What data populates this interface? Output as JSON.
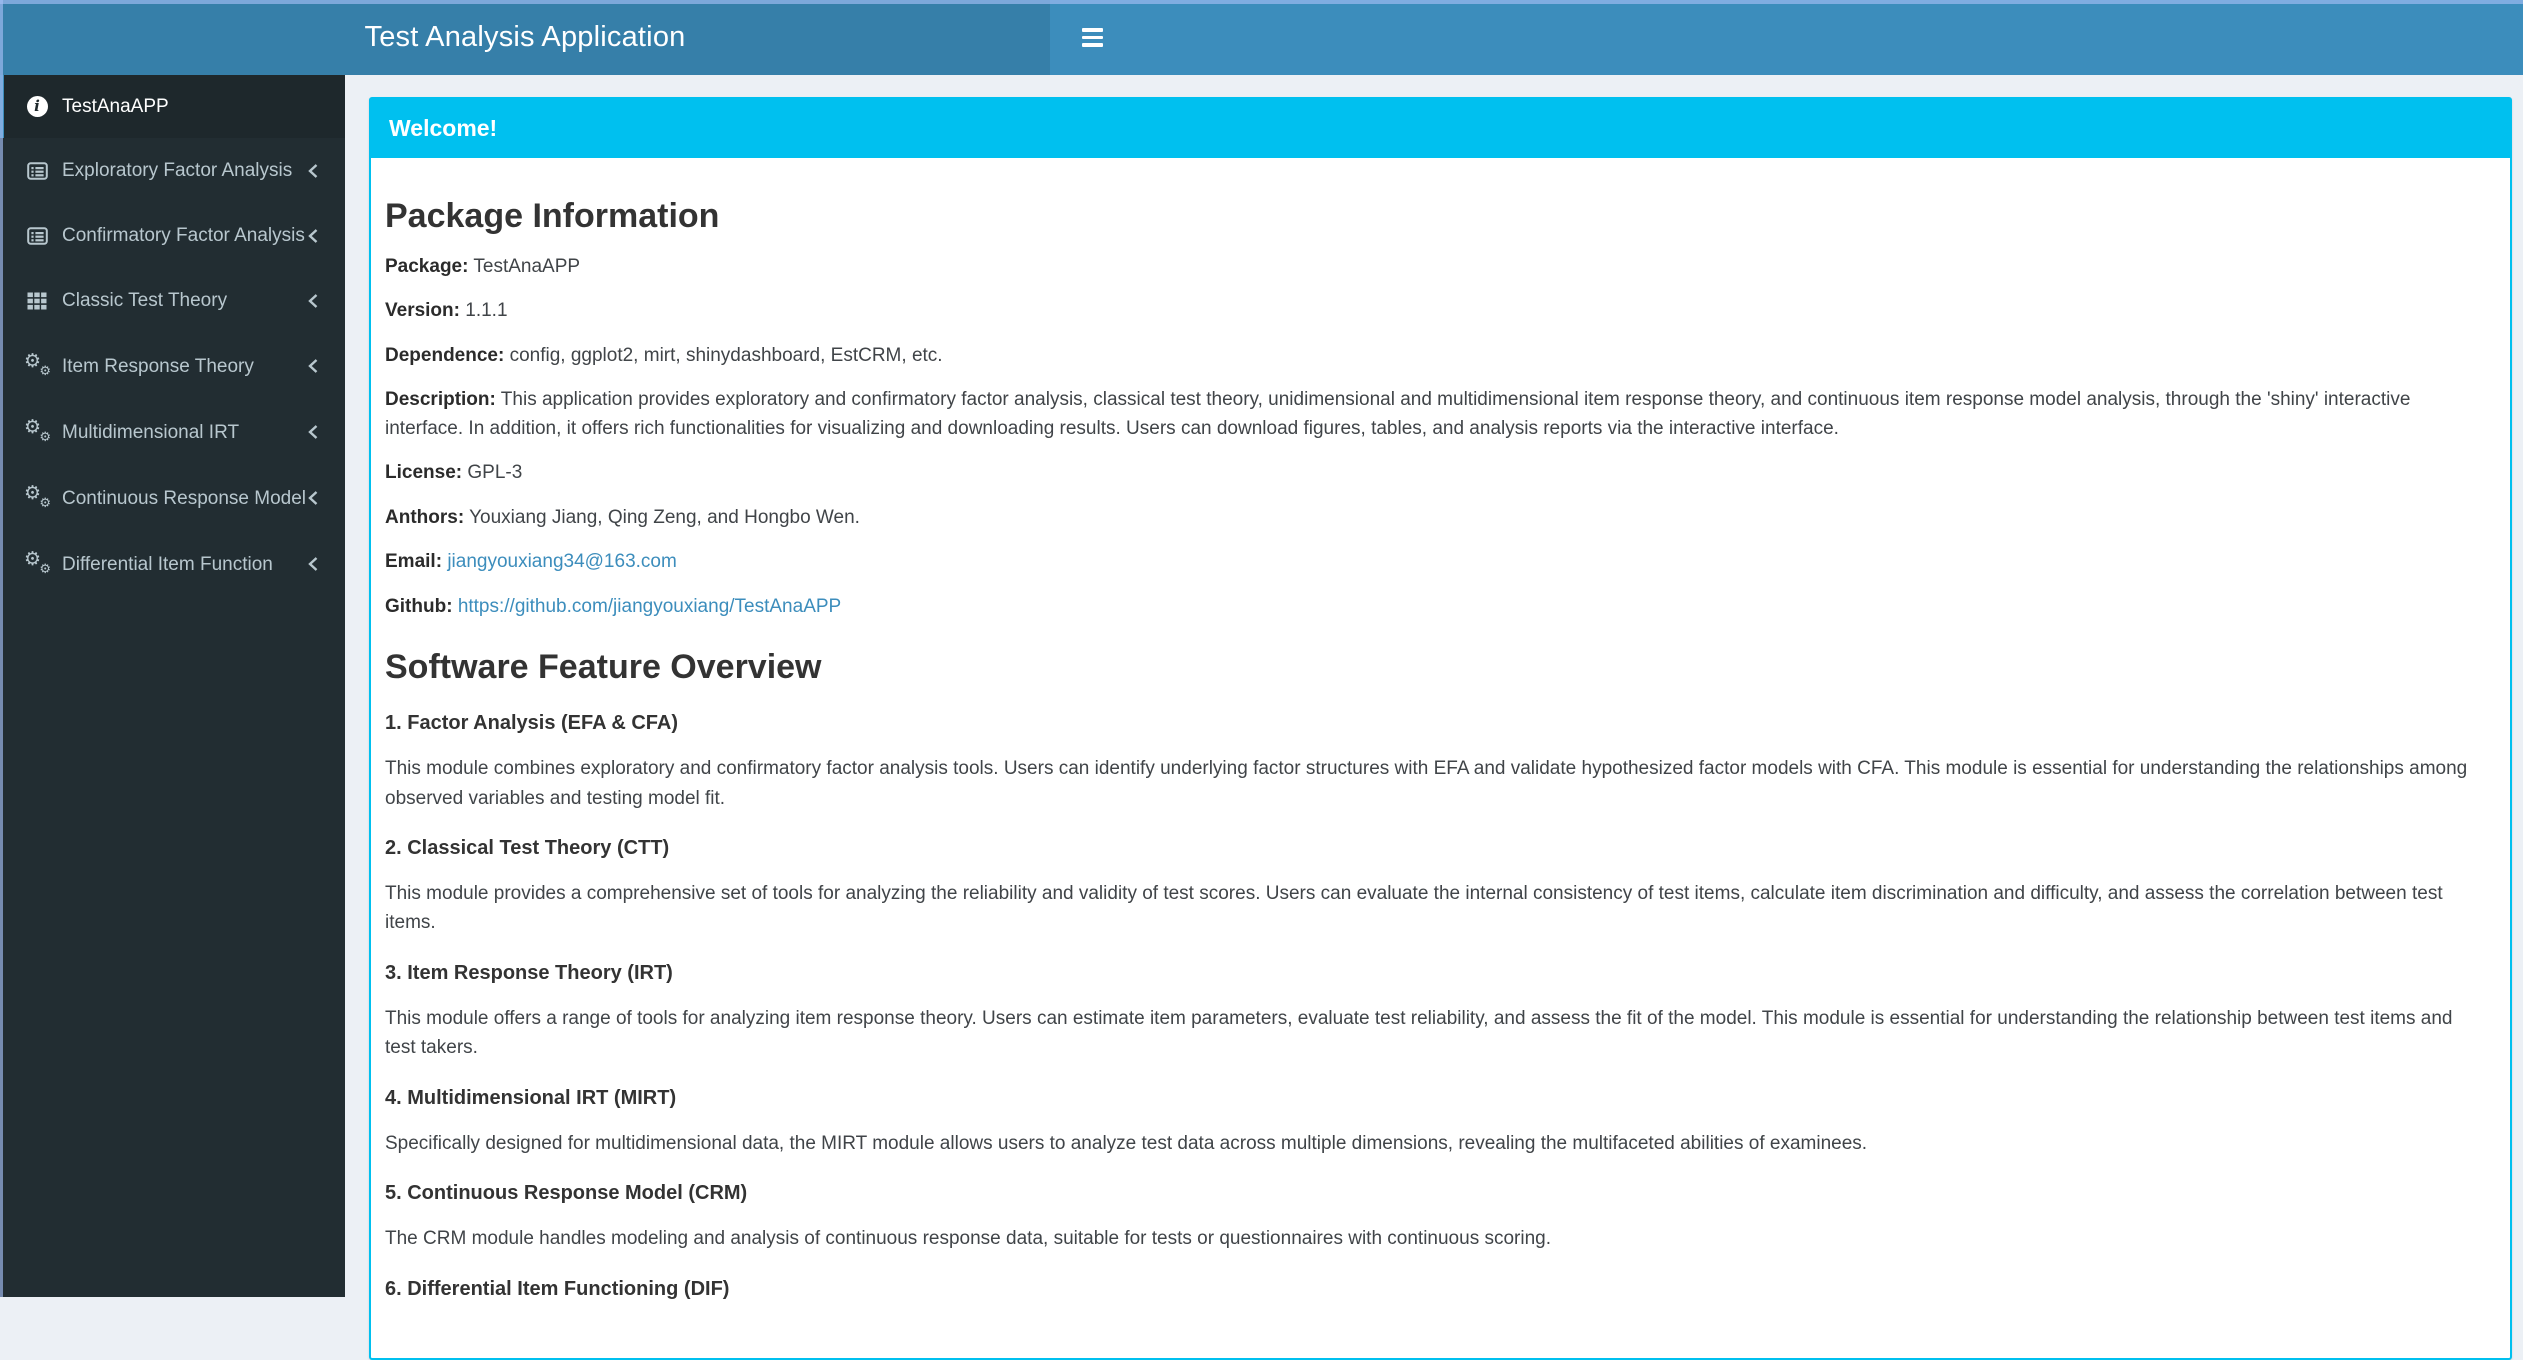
{
  "header": {
    "title": "Test Analysis Application"
  },
  "sidebar": {
    "items": [
      {
        "label": "TestAnaAPP",
        "icon": "info-circle",
        "active": true
      },
      {
        "label": "Exploratory Factor Analysis",
        "icon": "list-alt",
        "active": false
      },
      {
        "label": "Confirmatory Factor Analysis",
        "icon": "list-alt",
        "active": false
      },
      {
        "label": "Classic Test Theory",
        "icon": "table",
        "active": false
      },
      {
        "label": "Item Response Theory",
        "icon": "gears",
        "active": false
      },
      {
        "label": "Multidimensional IRT",
        "icon": "gears",
        "active": false
      },
      {
        "label": "Continuous Response Model",
        "icon": "gears",
        "active": false
      },
      {
        "label": "Differential Item Function",
        "icon": "gears",
        "active": false
      }
    ]
  },
  "main": {
    "box_title": "Welcome!",
    "package_info": {
      "heading": "Package Information",
      "fields": [
        {
          "label": "Package:",
          "value": "TestAnaAPP"
        },
        {
          "label": "Version:",
          "value": "1.1.1"
        },
        {
          "label": "Dependence:",
          "value": "config, ggplot2, mirt, shinydashboard, EstCRM, etc."
        },
        {
          "label": "Description:",
          "value": "This application provides exploratory and confirmatory factor analysis, classical test theory, unidimensional and multidimensional item response theory, and continuous item response model analysis, through the 'shiny' interactive interface. In addition, it offers rich functionalities for visualizing and downloading results. Users can download figures, tables, and analysis reports via the interactive interface."
        },
        {
          "label": "License:",
          "value": "GPL-3"
        },
        {
          "label": "Anthors:",
          "value": "Youxiang Jiang, Qing Zeng, and Hongbo Wen."
        },
        {
          "label": "Email:",
          "value": "jiangyouxiang34@163.com"
        },
        {
          "label": "Github:",
          "value": "https://github.com/jiangyouxiang/TestAnaAPP"
        }
      ]
    },
    "features": {
      "heading": "Software Feature Overview",
      "items": [
        {
          "title": "1. Factor Analysis (EFA & CFA)",
          "text": "This module combines exploratory and confirmatory factor analysis tools. Users can identify underlying factor structures with EFA and validate hypothesized factor models with CFA. This module is essential for understanding the relationships among observed variables and testing model fit."
        },
        {
          "title": "2. Classical Test Theory (CTT)",
          "text": "This module provides a comprehensive set of tools for analyzing the reliability and validity of test scores. Users can evaluate the internal consistency of test items, calculate item discrimination and difficulty, and assess the correlation between test items."
        },
        {
          "title": "3. Item Response Theory (IRT)",
          "text": "This module offers a range of tools for analyzing item response theory. Users can estimate item parameters, evaluate test reliability, and assess the fit of the model. This module is essential for understanding the relationship between test items and test takers."
        },
        {
          "title": "4. Multidimensional IRT (MIRT)",
          "text": "Specifically designed for multidimensional data, the MIRT module allows users to analyze test data across multiple dimensions, revealing the multifaceted abilities of examinees."
        },
        {
          "title": "5. Continuous Response Model (CRM)",
          "text": "The CRM module handles modeling and analysis of continuous response data, suitable for tests or questionnaires with continuous scoring."
        },
        {
          "title": "6. Differential Item Functioning (DIF)"
        }
      ]
    }
  },
  "colors": {
    "navbar": "#3c8dbc",
    "logo": "#367fa9",
    "sidebar": "#222d32",
    "sidebar_active_bg": "#1e282c",
    "accent": "#3c8dbc",
    "box_accent": "#00c0ef",
    "content_bg": "#ecf0f5",
    "link": "#3c8dbc",
    "sidebar_text": "#b8c7ce"
  },
  "icons": {
    "info_glyph": "i",
    "gear_glyph": "⚙"
  }
}
